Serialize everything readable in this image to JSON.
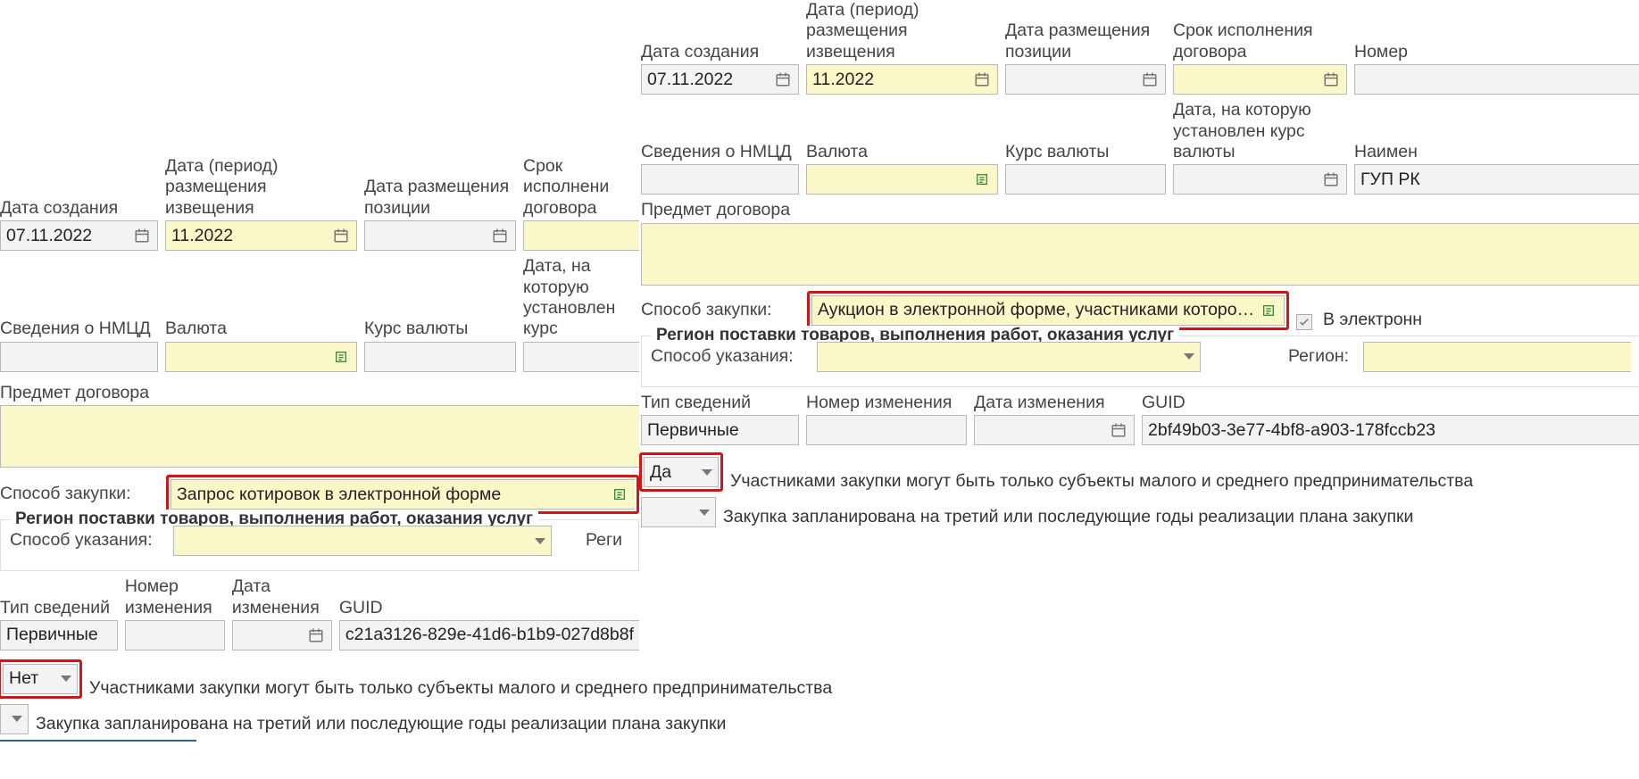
{
  "labels": {
    "creation_date": "Дата создания",
    "notice_period": "Дата (период)\nразмещения извещения",
    "placement_date": "Дата размещения\nпозиции",
    "exec_deadline": "Срок исполнения\nдоговора",
    "number": "Номер",
    "nmcd_info": "Сведения о НМЦД",
    "currency": "Валюта",
    "exchange_rate": "Курс валюты",
    "rate_date": "Дата, на которую\nустановлен курс валюты",
    "rate_date_trunc": "Дата, на которую\nустановлен курс",
    "exec_deadline_trunc": "Срок исполнени\nдоговора",
    "naimen": "Наимен",
    "contract_subject": "Предмет договора",
    "purchase_method": "Способ закупки:",
    "region_indication": "Способ указания:",
    "region": "Регион:",
    "info_type": "Тип сведений",
    "change_number": "Номер изменения",
    "change_date": "Дата изменения",
    "guid": "GUID",
    "electronic": "В электронн",
    "region_group": "Регион поставки товаров, выполнения работ, оказания услуг",
    "smb_text": "Участниками закупки могут быть только субъекты малого и среднего предпринимательства",
    "planned_text": "Закупка запланирована на третий или последующие годы реализации плана закупки"
  },
  "left": {
    "creation_date": "07.11.2022",
    "notice_period": "11.2022",
    "purchase_method": "Запрос котировок в электронной форме",
    "info_type": "Первичные",
    "guid": "c21a3126-829e-41d6-b1b9-027d8b8f",
    "smb_value": "Нет"
  },
  "right": {
    "creation_date": "07.11.2022",
    "notice_period": "11.2022",
    "purchase_method": "Аукцион в электронной форме, участниками которого могут",
    "info_type": "Первичные",
    "guid": "2bf49b03-3e77-4bf8-a903-178fccb23",
    "naimen": "ГУП РК",
    "smb_value": "Да"
  }
}
